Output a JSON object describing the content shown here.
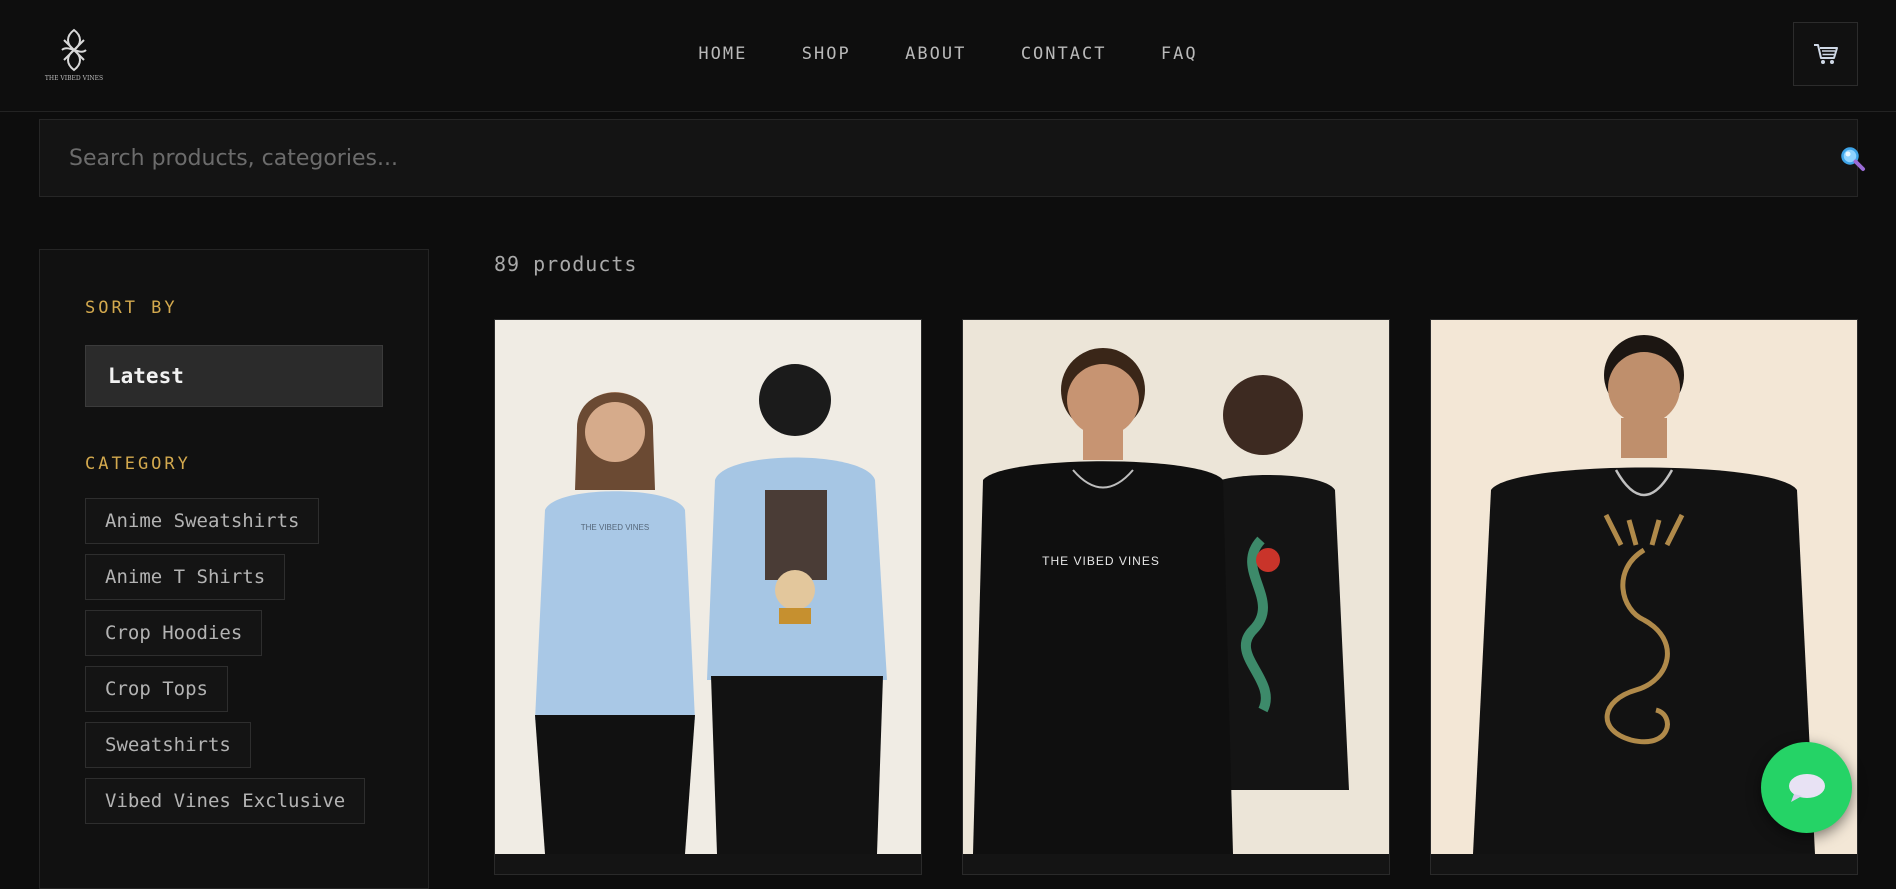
{
  "brand": {
    "logo_icon": "vibed-vines-logo-icon",
    "logo_text": "THE VIBED VINES"
  },
  "nav": {
    "items": [
      "HOME",
      "SHOP",
      "ABOUT",
      "CONTACT",
      "FAQ"
    ]
  },
  "header": {
    "cart_icon": "shopping-cart-icon"
  },
  "search": {
    "placeholder": "Search products, categories...",
    "icon": "magnifier-icon"
  },
  "filters": {
    "sort_title": "SORT BY",
    "sort_value": "Latest",
    "category_title": "CATEGORY",
    "categories": [
      "Anime Sweatshirts",
      "Anime T Shirts",
      "Crop Hoodies",
      "Crop Tops",
      "Sweatshirts",
      "Vibed Vines Exclusive"
    ]
  },
  "results": {
    "count_label": "89 products"
  },
  "products": [
    {
      "image": "light blue anime sweatshirt worn by two models",
      "print_text": "THE VIBED VINES"
    },
    {
      "image": "black dragon sweatshirt worn by two models",
      "print_text": "THE VIBED VINES"
    },
    {
      "image": "black sweatshirt with golden dragon print",
      "print_text": ""
    }
  ],
  "chat": {
    "icon": "chat-bubble-icon"
  },
  "colors": {
    "accent": "#d3a94e",
    "background": "#0d0d0d",
    "chat": "#25d366"
  }
}
